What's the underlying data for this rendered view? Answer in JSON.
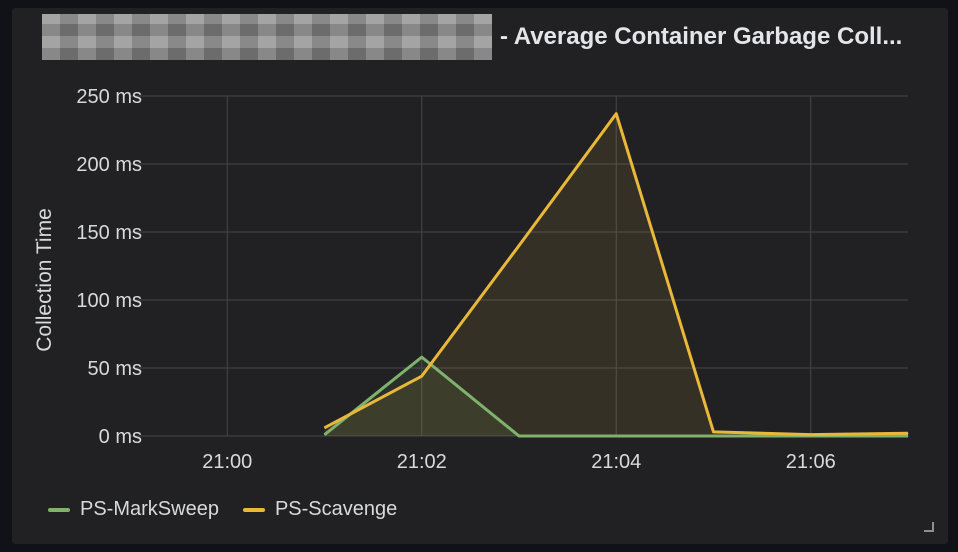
{
  "panel": {
    "title": "- Average Container Garbage Coll..."
  },
  "colors": {
    "background": "#212124",
    "grid": "#46474a",
    "text": "#d8d9da",
    "mark_sweep": "#7eb26d",
    "scavenge": "#eab839"
  },
  "chart_data": {
    "type": "line",
    "ylabel": "Collection Time",
    "xlabel": "",
    "x_ticks": [
      "21:00",
      "21:02",
      "21:04",
      "21:06"
    ],
    "y_ticks": [
      "0 ms",
      "50 ms",
      "100 ms",
      "150 ms",
      "200 ms",
      "250 ms"
    ],
    "ylim": [
      0,
      250
    ],
    "xlim": [
      "20:59",
      "21:07"
    ],
    "grid": true,
    "legend_position": "bottom-left",
    "x": [
      "21:01",
      "21:02",
      "21:03",
      "21:04",
      "21:05",
      "21:06",
      "21:07"
    ],
    "series": [
      {
        "name": "PS-MarkSweep",
        "color": "#7eb26d",
        "values": [
          1,
          58,
          0,
          0,
          0,
          0,
          0
        ],
        "fill": true
      },
      {
        "name": "PS-Scavenge",
        "color": "#eab839",
        "values": [
          6,
          44,
          140,
          237,
          3,
          1,
          2
        ],
        "fill": true
      }
    ]
  }
}
